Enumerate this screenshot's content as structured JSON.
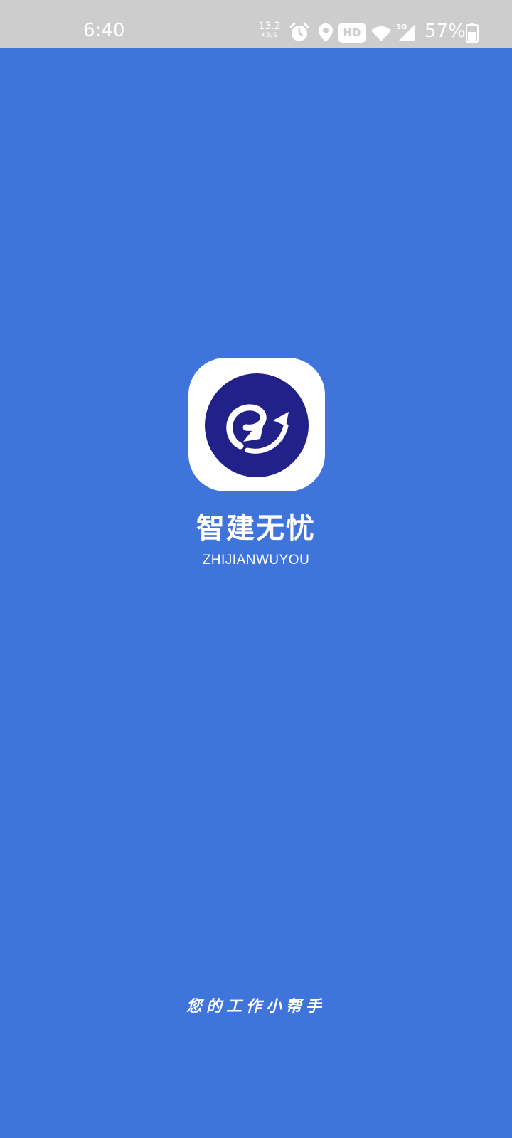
{
  "status_bar": {
    "time": "6:40",
    "net_speed_value": "13.2",
    "net_speed_unit": "KB/S",
    "hd_label": "HD",
    "network_type": "5G",
    "battery_percent": "57%",
    "icons": [
      "alarm-icon",
      "location-icon",
      "hd-badge",
      "wifi-icon",
      "cellular-5g-icon",
      "battery-icon"
    ]
  },
  "splash": {
    "app_name": "智建无忧",
    "app_name_pinyin": "ZHIJIANWUYOU",
    "slogan": "您的工作小帮手"
  },
  "colors": {
    "background": "#3F75DB",
    "status_bar": "#CDCDCD",
    "logo_disc": "#22218A",
    "text": "#FFFFFF"
  }
}
